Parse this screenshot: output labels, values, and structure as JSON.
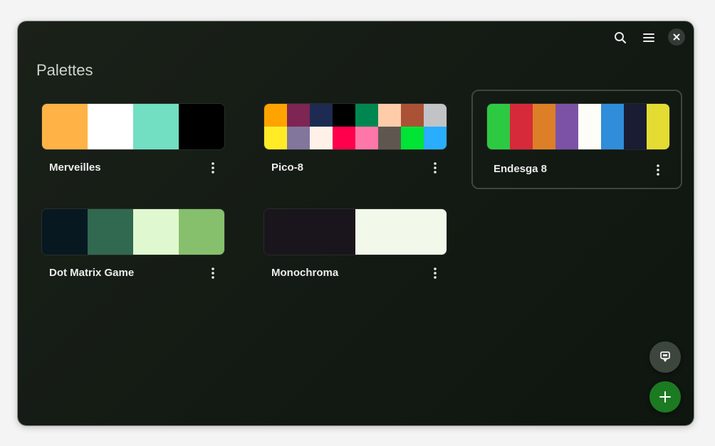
{
  "header": {
    "title": "Palettes",
    "actions": [
      {
        "name": "search-button",
        "icon": "search-icon"
      },
      {
        "name": "main-menu-button",
        "icon": "hamburger-menu-icon"
      },
      {
        "name": "close-button",
        "icon": "close-icon"
      }
    ]
  },
  "palettes": [
    {
      "name": "Merveilles",
      "colors": [
        "#ffb245",
        "#ffffff",
        "#72dec2",
        "#000000"
      ],
      "rows": 1,
      "selected": false
    },
    {
      "name": "Pico-8",
      "colors": [
        "#ffa300",
        "#7e2553",
        "#1d2b53",
        "#000000",
        "#008751",
        "#ffccaa",
        "#ab5236",
        "#c2c3c7",
        "#ffec27",
        "#83769c",
        "#fff1e8",
        "#ff004d",
        "#ff77a8",
        "#5f574f",
        "#00e436",
        "#29adff"
      ],
      "rows": 2,
      "selected": false
    },
    {
      "name": "Endesga 8",
      "colors": [
        "#2ec943",
        "#d62a3a",
        "#dd7f27",
        "#7c52a7",
        "#fdfdf8",
        "#2f8dd9",
        "#1a1c33",
        "#e4dc32"
      ],
      "rows": 1,
      "selected": true
    },
    {
      "name": "Dot Matrix Game",
      "colors": [
        "#071821",
        "#306850",
        "#e0f8cf",
        "#86c06c"
      ],
      "rows": 1,
      "selected": false
    },
    {
      "name": "Monochroma",
      "colors": [
        "#1a151c",
        "#f2f8ea"
      ],
      "rows": 1,
      "selected": false
    }
  ],
  "fabs": [
    {
      "name": "color-picker-button",
      "icon": "eyedropper-icon"
    },
    {
      "name": "add-palette-button",
      "icon": "plus-icon"
    }
  ]
}
